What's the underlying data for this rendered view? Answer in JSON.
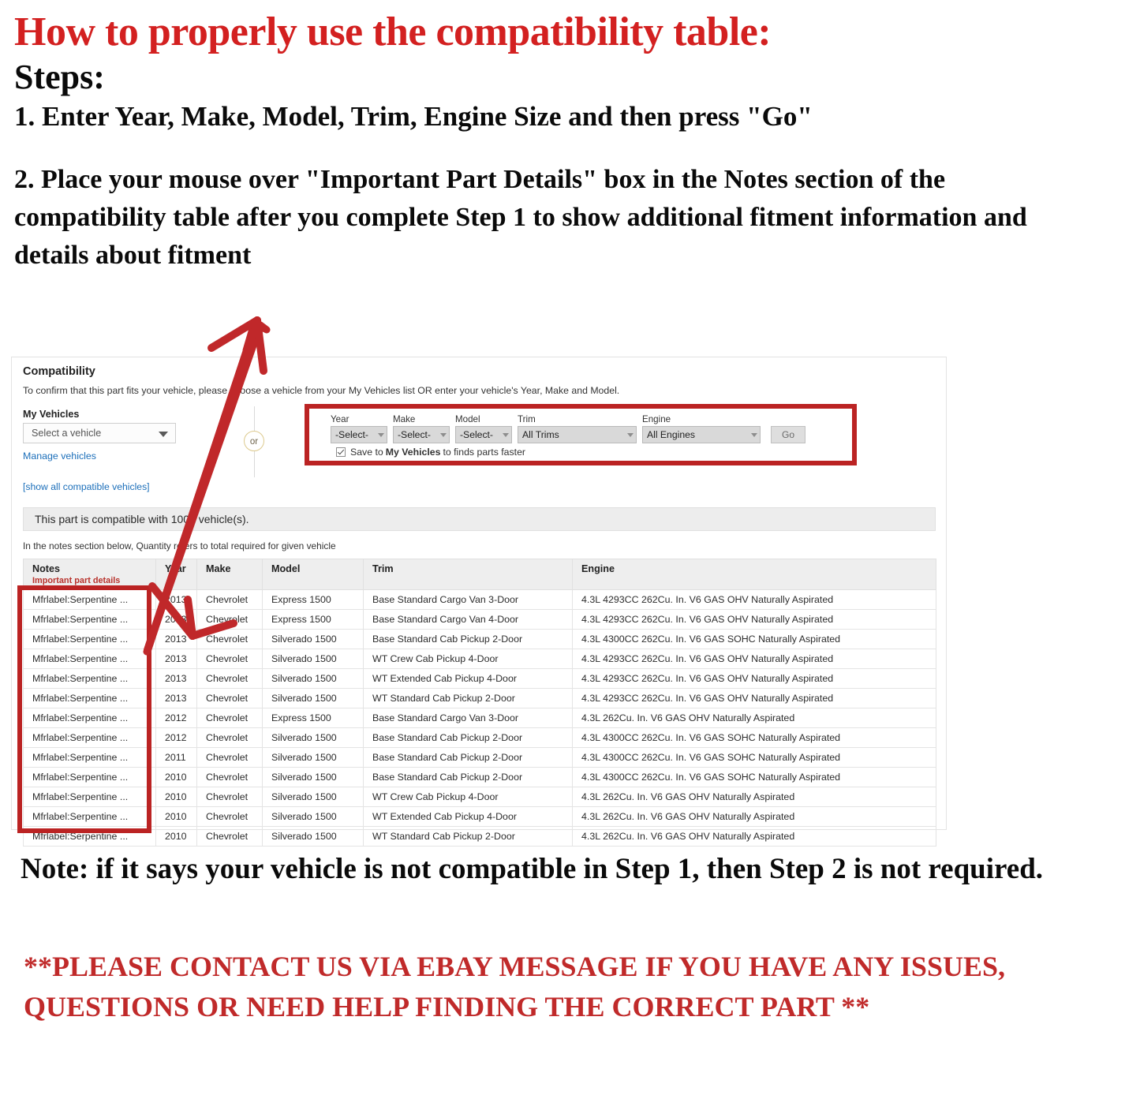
{
  "instructions": {
    "headline": "How to properly use the compatibility table:",
    "steps_label": "Steps:",
    "step1": "1. Enter Year, Make, Model, Trim, Engine Size and then press \"Go\"",
    "step2": "2. Place your mouse over \"Important Part Details\" box in the Notes section of the compatibility table after you complete Step 1 to show additional fitment information and details about fitment",
    "note": "Note: if it says your vehicle is not compatible in Step 1, then Step 2 is not required.",
    "contact": "**PLEASE CONTACT US VIA EBAY MESSAGE IF YOU HAVE ANY ISSUES, QUESTIONS OR NEED HELP FINDING THE CORRECT PART **"
  },
  "panel": {
    "title": "Compatibility",
    "subtitle": "To confirm that this part fits your vehicle, please choose a vehicle from your My Vehicles list OR enter your vehicle's Year, Make and Model.",
    "my_vehicles_label": "My Vehicles",
    "vehicle_select_value": "Select a vehicle",
    "manage_link": "Manage vehicles",
    "show_all_link": "[show all compatible vehicles]",
    "or_text": "or",
    "banner_text": "This part is compatible with 1000 vehicle(s).",
    "notes_hint": "In the notes section below, Quantity refers to total required for given vehicle"
  },
  "form": {
    "year": {
      "label": "Year",
      "value": "-Select-"
    },
    "make": {
      "label": "Make",
      "value": "-Select-"
    },
    "model": {
      "label": "Model",
      "value": "-Select-"
    },
    "trim": {
      "label": "Trim",
      "value": "All Trims"
    },
    "engine": {
      "label": "Engine",
      "value": "All Engines"
    },
    "go_label": "Go",
    "save_prefix": "Save to",
    "save_bold": "My Vehicles",
    "save_suffix": "to finds parts faster"
  },
  "table": {
    "headers": {
      "notes": "Notes",
      "notes_sub": "Important part details",
      "year": "Year",
      "make": "Make",
      "model": "Model",
      "trim": "Trim",
      "engine": "Engine"
    },
    "rows": [
      {
        "notes": "Mfrlabel:Serpentine ...",
        "year": "2013",
        "make": "Chevrolet",
        "model": "Express 1500",
        "trim": "Base Standard Cargo Van 3-Door",
        "engine": "4.3L 4293CC 262Cu. In. V6 GAS OHV Naturally Aspirated"
      },
      {
        "notes": "Mfrlabel:Serpentine ...",
        "year": "2013",
        "make": "Chevrolet",
        "model": "Express 1500",
        "trim": "Base Standard Cargo Van 4-Door",
        "engine": "4.3L 4293CC 262Cu. In. V6 GAS OHV Naturally Aspirated"
      },
      {
        "notes": "Mfrlabel:Serpentine ...",
        "year": "2013",
        "make": "Chevrolet",
        "model": "Silverado 1500",
        "trim": "Base Standard Cab Pickup 2-Door",
        "engine": "4.3L 4300CC 262Cu. In. V6 GAS SOHC Naturally Aspirated"
      },
      {
        "notes": "Mfrlabel:Serpentine ...",
        "year": "2013",
        "make": "Chevrolet",
        "model": "Silverado 1500",
        "trim": "WT Crew Cab Pickup 4-Door",
        "engine": "4.3L 4293CC 262Cu. In. V6 GAS OHV Naturally Aspirated"
      },
      {
        "notes": "Mfrlabel:Serpentine ...",
        "year": "2013",
        "make": "Chevrolet",
        "model": "Silverado 1500",
        "trim": "WT Extended Cab Pickup 4-Door",
        "engine": "4.3L 4293CC 262Cu. In. V6 GAS OHV Naturally Aspirated"
      },
      {
        "notes": "Mfrlabel:Serpentine ...",
        "year": "2013",
        "make": "Chevrolet",
        "model": "Silverado 1500",
        "trim": "WT Standard Cab Pickup 2-Door",
        "engine": "4.3L 4293CC 262Cu. In. V6 GAS OHV Naturally Aspirated"
      },
      {
        "notes": "Mfrlabel:Serpentine ...",
        "year": "2012",
        "make": "Chevrolet",
        "model": "Express 1500",
        "trim": "Base Standard Cargo Van 3-Door",
        "engine": "4.3L 262Cu. In. V6 GAS OHV Naturally Aspirated"
      },
      {
        "notes": "Mfrlabel:Serpentine ...",
        "year": "2012",
        "make": "Chevrolet",
        "model": "Silverado 1500",
        "trim": "Base Standard Cab Pickup 2-Door",
        "engine": "4.3L 4300CC 262Cu. In. V6 GAS SOHC Naturally Aspirated"
      },
      {
        "notes": "Mfrlabel:Serpentine ...",
        "year": "2011",
        "make": "Chevrolet",
        "model": "Silverado 1500",
        "trim": "Base Standard Cab Pickup 2-Door",
        "engine": "4.3L 4300CC 262Cu. In. V6 GAS SOHC Naturally Aspirated"
      },
      {
        "notes": "Mfrlabel:Serpentine ...",
        "year": "2010",
        "make": "Chevrolet",
        "model": "Silverado 1500",
        "trim": "Base Standard Cab Pickup 2-Door",
        "engine": "4.3L 4300CC 262Cu. In. V6 GAS SOHC Naturally Aspirated"
      },
      {
        "notes": "Mfrlabel:Serpentine ...",
        "year": "2010",
        "make": "Chevrolet",
        "model": "Silverado 1500",
        "trim": "WT Crew Cab Pickup 4-Door",
        "engine": "4.3L 262Cu. In. V6 GAS OHV Naturally Aspirated"
      },
      {
        "notes": "Mfrlabel:Serpentine ...",
        "year": "2010",
        "make": "Chevrolet",
        "model": "Silverado 1500",
        "trim": "WT Extended Cab Pickup 4-Door",
        "engine": "4.3L 262Cu. In. V6 GAS OHV Naturally Aspirated"
      },
      {
        "notes": "Mfrlabel:Serpentine ...",
        "year": "2010",
        "make": "Chevrolet",
        "model": "Silverado 1500",
        "trim": "WT Standard Cab Pickup 2-Door",
        "engine": "4.3L 262Cu. In. V6 GAS OHV Naturally Aspirated"
      }
    ]
  },
  "colors": {
    "headline_red": "#d32020",
    "annotation_red": "#bb2323",
    "contact_red": "#c02a2a",
    "link_blue": "#1c6fba",
    "important_red": "#b8322c"
  }
}
